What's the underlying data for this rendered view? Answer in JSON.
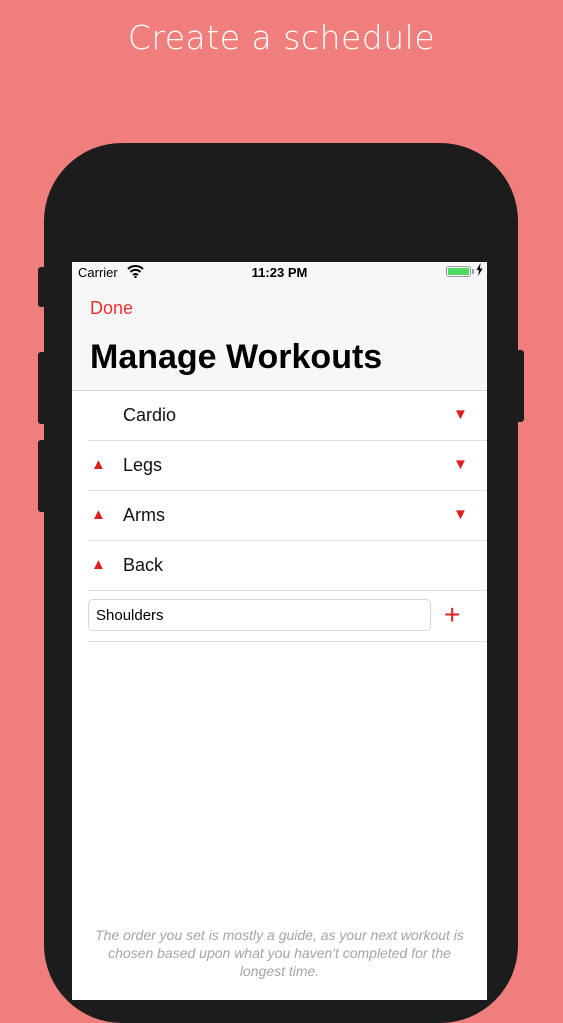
{
  "promo": {
    "title": "Create a schedule"
  },
  "status_bar": {
    "carrier": "Carrier",
    "time": "11:23 PM",
    "wifi_icon": "wifi-icon",
    "battery_icon": "battery-icon",
    "charging_icon": "charging-bolt-icon",
    "battery_level": 1.0
  },
  "nav": {
    "done_label": "Done",
    "title": "Manage Workouts"
  },
  "workouts": [
    {
      "name": "Cardio",
      "can_move_up": false,
      "can_move_down": true
    },
    {
      "name": "Legs",
      "can_move_up": true,
      "can_move_down": true
    },
    {
      "name": "Arms",
      "can_move_up": true,
      "can_move_down": true
    },
    {
      "name": "Back",
      "can_move_up": true,
      "can_move_down": false
    }
  ],
  "arrows": {
    "up": "▲",
    "down": "▼"
  },
  "add_workout": {
    "value": "Shoulders",
    "add_label": "+"
  },
  "footer_note": "The order you set is mostly a guide, as your next workout is chosen based upon what you haven't completed for the longest time.",
  "colors": {
    "background": "#F07E7D",
    "accent": "#E8322F",
    "arrow": "#E01E1E",
    "battery": "#4cd964"
  }
}
